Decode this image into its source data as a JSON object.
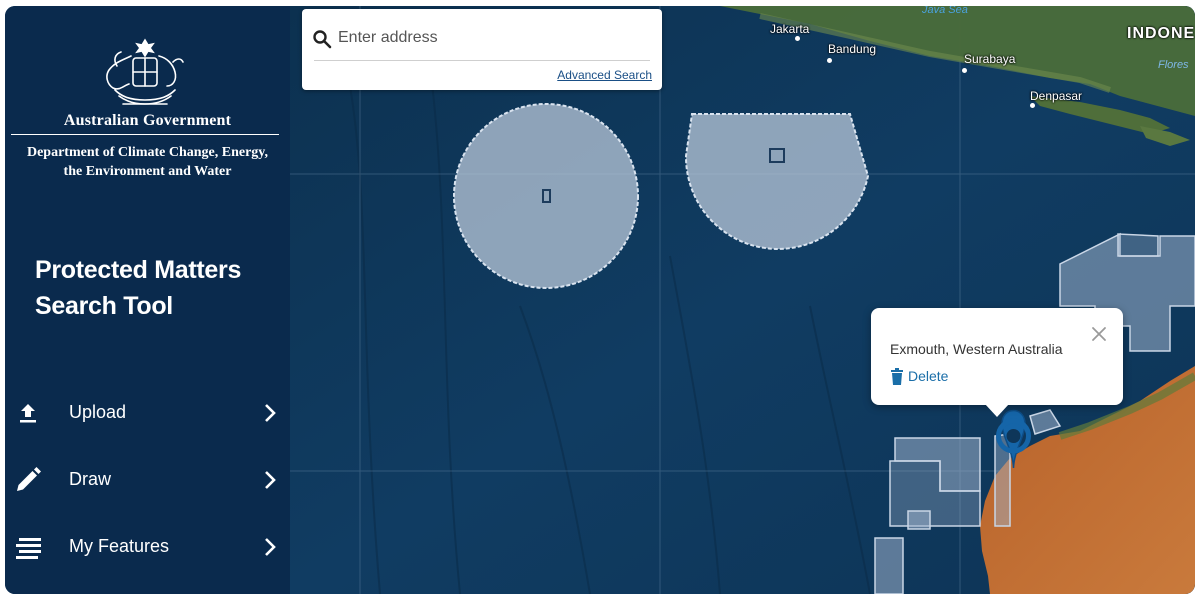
{
  "sidebar": {
    "gov_name": "Australian Government",
    "dept_line1": "Department of Climate Change, Energy,",
    "dept_line2": "the Environment and Water",
    "tool_title_line1": "Protected Matters",
    "tool_title_line2": "Search Tool",
    "items": [
      {
        "label": "Upload",
        "icon": "upload-icon"
      },
      {
        "label": "Draw",
        "icon": "pencil-icon"
      },
      {
        "label": "My Features",
        "icon": "list-icon"
      }
    ]
  },
  "search": {
    "placeholder": "Enter address",
    "advanced_label": "Advanced Search"
  },
  "popup": {
    "title": "Exmouth, Western Australia",
    "delete_label": "Delete"
  },
  "map_labels": {
    "java_sea": "Java Sea",
    "jakarta": "Jakarta",
    "bandung": "Bandung",
    "surabaya": "Surabaya",
    "denpasar": "Denpasar",
    "indonesia": "INDONE",
    "flores": "Flores"
  },
  "colors": {
    "sidebar": "#0a2a4d",
    "ocean": "#0e3659",
    "link": "#1a4f86",
    "marker": "#1565a8"
  }
}
